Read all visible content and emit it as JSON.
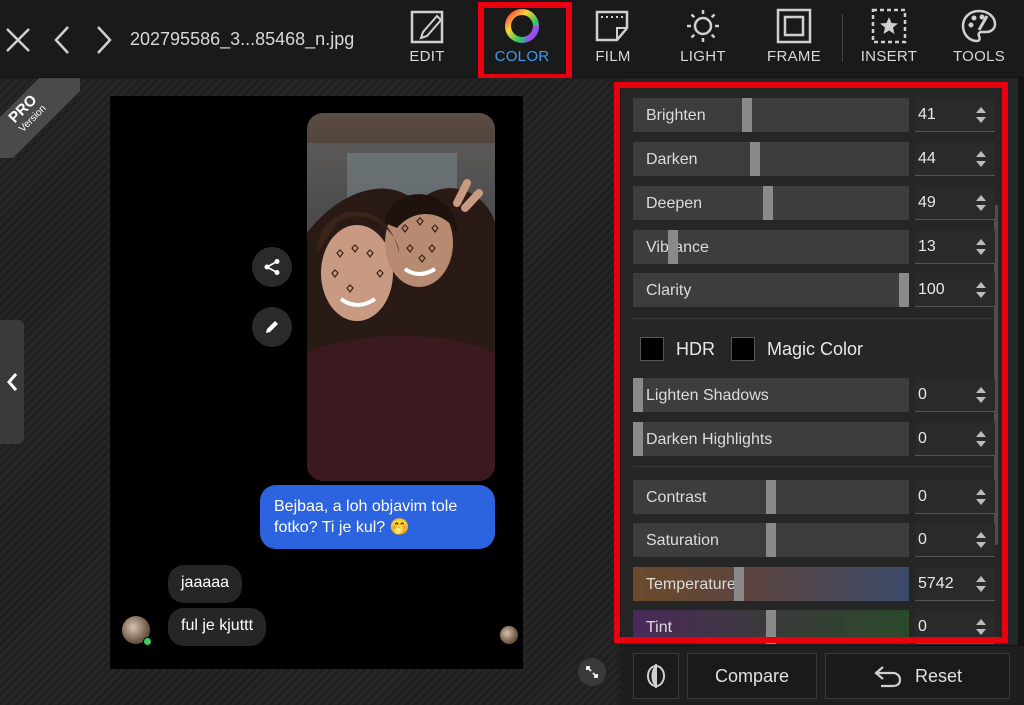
{
  "window": {
    "file_name": "202795586_3...85468_n.jpg"
  },
  "toolbar": {
    "tools": [
      {
        "id": "edit",
        "label": "EDIT",
        "icon": "edit-icon"
      },
      {
        "id": "color",
        "label": "COLOR",
        "icon": "color-wheel-icon",
        "active": true
      },
      {
        "id": "film",
        "label": "FILM",
        "icon": "film-icon"
      },
      {
        "id": "light",
        "label": "LIGHT",
        "icon": "sun-icon"
      },
      {
        "id": "frame",
        "label": "FRAME",
        "icon": "frame-icon"
      },
      {
        "id": "insert",
        "label": "INSERT",
        "icon": "insert-star-icon"
      },
      {
        "id": "tools",
        "label": "TOOLS",
        "icon": "palette-icon"
      }
    ],
    "accent_color": "#3d9bf0",
    "highlight_color": "#e8000f"
  },
  "badge": {
    "pro": "PRO",
    "version": "Version"
  },
  "preview": {
    "outgoing_message": "Bejbaa, a loh objavim tole fotko? Ti je kul? 🤭",
    "incoming_messages": [
      "jaaaaa",
      "ful je kjuttt"
    ],
    "outgoing_bubble_color": "#2c64e0"
  },
  "panel": {
    "sliders_top": [
      {
        "id": "brighten",
        "label": "Brighten",
        "value": "41",
        "position": 0.41
      },
      {
        "id": "darken",
        "label": "Darken",
        "value": "44",
        "position": 0.44
      },
      {
        "id": "deepen",
        "label": "Deepen",
        "value": "49",
        "position": 0.49
      },
      {
        "id": "vibrance",
        "label": "Vibrance",
        "value": "13",
        "position": 0.13
      },
      {
        "id": "clarity",
        "label": "Clarity",
        "value": "100",
        "position": 1.0
      }
    ],
    "checkboxes": [
      {
        "id": "hdr",
        "label": "HDR",
        "checked": false
      },
      {
        "id": "magic-color",
        "label": "Magic Color",
        "checked": false
      }
    ],
    "sliders_mid": [
      {
        "id": "lighten-shadows",
        "label": "Lighten Shadows",
        "value": "0",
        "position": 0.0
      },
      {
        "id": "darken-highlights",
        "label": "Darken Highlights",
        "value": "0",
        "position": 0.0
      }
    ],
    "sliders_bottom": [
      {
        "id": "contrast",
        "label": "Contrast",
        "value": "0",
        "position": 0.5
      },
      {
        "id": "saturation",
        "label": "Saturation",
        "value": "0",
        "position": 0.5
      },
      {
        "id": "temperature",
        "label": "Temperature",
        "value": "5742",
        "position": 0.38
      },
      {
        "id": "tint",
        "label": "Tint",
        "value": "0",
        "position": 0.5
      }
    ]
  },
  "footer": {
    "compare_label": "Compare",
    "reset_label": "Reset"
  }
}
